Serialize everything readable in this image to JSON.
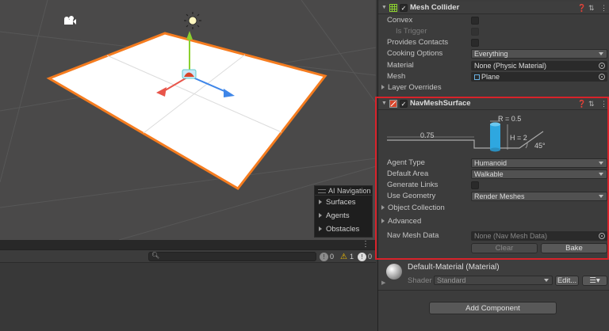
{
  "scene": {
    "ai_navigation": {
      "title": "AI Navigation",
      "items": [
        "Surfaces",
        "Agents",
        "Obstacles"
      ]
    }
  },
  "console": {
    "counts": {
      "info": "0",
      "warn": "1",
      "error": "0"
    }
  },
  "inspector": {
    "mesh_collider": {
      "title": "Mesh Collider",
      "convex_label": "Convex",
      "is_trigger_label": "Is Trigger",
      "provides_contacts_label": "Provides Contacts",
      "cooking_options_label": "Cooking Options",
      "cooking_options_value": "Everything",
      "material_label": "Material",
      "material_value": "None (Physic Material)",
      "mesh_label": "Mesh",
      "mesh_value": "Plane",
      "layer_overrides_label": "Layer Overrides"
    },
    "navmesh_surface": {
      "title": "NavMeshSurface",
      "diagram": {
        "radius": "R = 0.5",
        "height": "H = 2",
        "step": "0.75",
        "slope": "45°"
      },
      "agent_type_label": "Agent Type",
      "agent_type_value": "Humanoid",
      "default_area_label": "Default Area",
      "default_area_value": "Walkable",
      "generate_links_label": "Generate Links",
      "use_geometry_label": "Use Geometry",
      "use_geometry_value": "Render Meshes",
      "object_collection_label": "Object Collection",
      "advanced_label": "Advanced",
      "nav_mesh_data_label": "Nav Mesh Data",
      "nav_mesh_data_value": "None (Nav Mesh Data)",
      "clear_label": "Clear",
      "bake_label": "Bake"
    },
    "material": {
      "title": "Default-Material (Material)",
      "shader_label": "Shader",
      "shader_value": "Standard",
      "edit_label": "Edit..."
    },
    "add_component_label": "Add Component"
  },
  "colors": {
    "highlight": "#d8222a",
    "selection": "#f57c1f",
    "agent": "#2ea7e0"
  }
}
